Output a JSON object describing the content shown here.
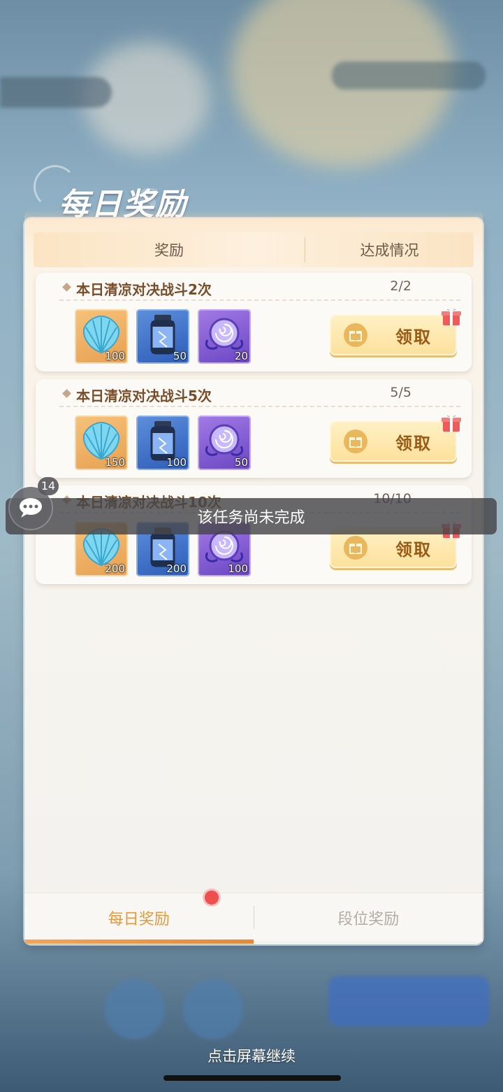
{
  "panel": {
    "title": "每日奖励",
    "header": {
      "reward_col": "奖励",
      "status_col": "达成情况"
    }
  },
  "tasks": [
    {
      "title": "本日清凉对决战斗2次",
      "progress": "2/2",
      "rewards": [
        {
          "icon": "shell-icon",
          "qty": "100"
        },
        {
          "icon": "bottle-icon",
          "qty": "50"
        },
        {
          "icon": "orb-icon",
          "qty": "20"
        }
      ],
      "claim_label": "领取"
    },
    {
      "title": "本日清凉对决战斗5次",
      "progress": "5/5",
      "rewards": [
        {
          "icon": "shell-icon",
          "qty": "150"
        },
        {
          "icon": "bottle-icon",
          "qty": "100"
        },
        {
          "icon": "orb-icon",
          "qty": "50"
        }
      ],
      "claim_label": "领取"
    },
    {
      "title": "本日清凉对决战斗10次",
      "progress": "10/10",
      "rewards": [
        {
          "icon": "shell-icon",
          "qty": "200"
        },
        {
          "icon": "bottle-icon",
          "qty": "200"
        },
        {
          "icon": "orb-icon",
          "qty": "100"
        }
      ],
      "claim_label": "领取"
    }
  ],
  "toast": {
    "message": "该任务尚未完成"
  },
  "chat": {
    "unread_count": "14"
  },
  "tabs": [
    {
      "label": "每日奖励",
      "active": true
    },
    {
      "label": "段位奖励",
      "active": false
    }
  ],
  "continue_hint": "点击屏幕继续",
  "colors": {
    "accent": "#e59a3d",
    "claim_text": "#9a5a17",
    "task_title": "#7a4d2a",
    "red_dot": "#ee4f4f"
  }
}
